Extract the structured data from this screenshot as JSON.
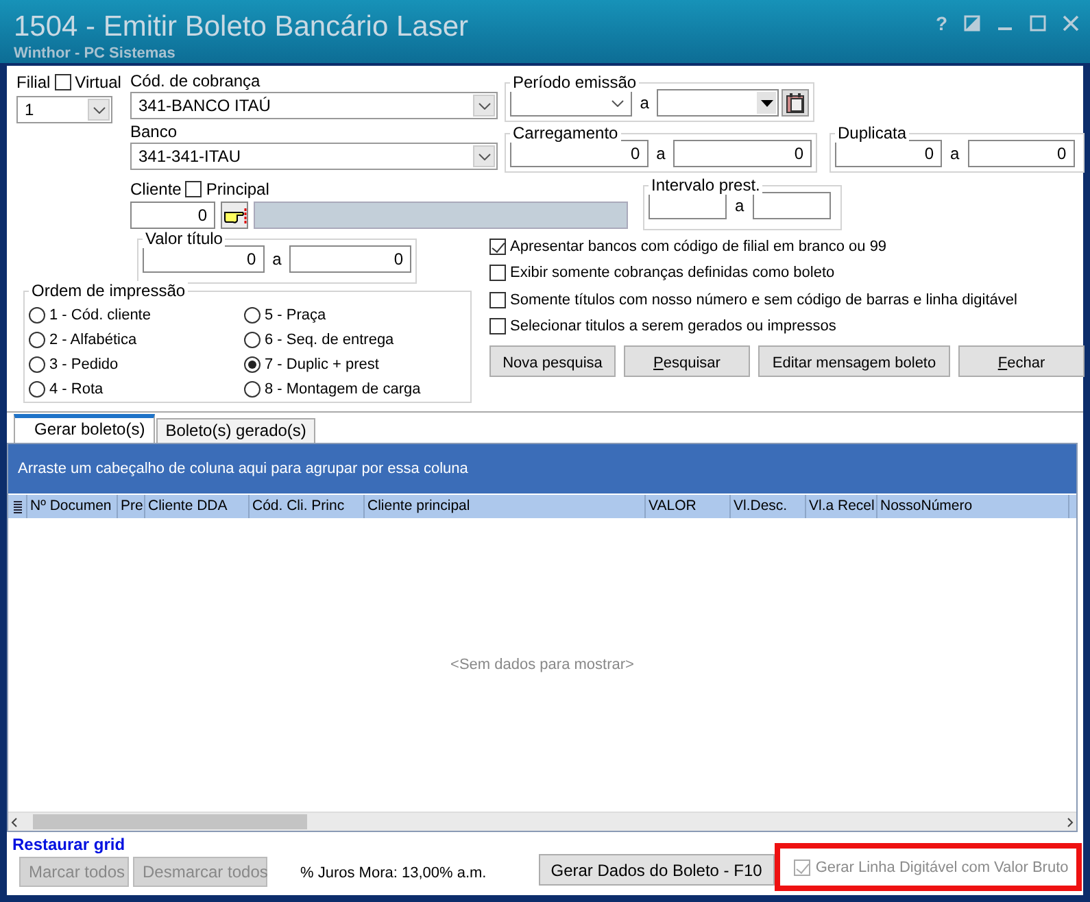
{
  "window": {
    "title": "1504 - Emitir Boleto Bancário Laser",
    "subtitle": "Winthor - PC Sistemas",
    "help": "?"
  },
  "filial": {
    "label": "Filial",
    "value": "1",
    "virtual": {
      "label": "Virtual",
      "checked": false
    }
  },
  "cod_cobranca": {
    "label": "Cód. de cobrança",
    "value": "341-BANCO ITAÚ"
  },
  "banco": {
    "label": "Banco",
    "value": "341-341-ITAU"
  },
  "periodo_emissao": {
    "label": "Período emissão",
    "separator": "a"
  },
  "carregamento": {
    "label": "Carregamento",
    "from": "0",
    "separator": "a",
    "to": "0"
  },
  "duplicata": {
    "label": "Duplicata",
    "from": "0",
    "separator": "a",
    "to": "0"
  },
  "cliente": {
    "label": "Cliente",
    "value": "0",
    "principal": {
      "label": "Principal",
      "checked": false
    }
  },
  "intervalo_prest": {
    "label": "Intervalo prest.",
    "separator": "a"
  },
  "valor_titulo": {
    "label": "Valor título",
    "from": "0",
    "separator": "a",
    "to": "0"
  },
  "ordem_impressao": {
    "label": "Ordem de impressão",
    "options": [
      {
        "label": "1 - Cód. cliente",
        "selected": false
      },
      {
        "label": "2 - Alfabética",
        "selected": false
      },
      {
        "label": "3 - Pedido",
        "selected": false
      },
      {
        "label": "4 - Rota",
        "selected": false
      },
      {
        "label": "5 - Praça",
        "selected": false
      },
      {
        "label": "6 - Seq. de entrega",
        "selected": false
      },
      {
        "label": "7 - Duplic + prest",
        "selected": true
      },
      {
        "label": "8 - Montagem de carga",
        "selected": false
      }
    ]
  },
  "options": [
    {
      "label": "Apresentar bancos com código de filial em branco ou 99",
      "checked": true
    },
    {
      "label": "Exibir somente cobranças definidas como boleto",
      "checked": false
    },
    {
      "label": "Somente títulos com nosso número e sem código de barras e linha digitável",
      "checked": false
    },
    {
      "label": "Selecionar titulos a serem gerados ou impressos",
      "checked": false
    }
  ],
  "buttons": [
    {
      "label": "Nova pesquisa"
    },
    {
      "parts": [
        {
          "text": "P",
          "underlined": true
        },
        {
          "text": "esquisar",
          "underlined": false
        }
      ]
    },
    {
      "label": "Editar mensagem boleto"
    },
    {
      "parts": [
        {
          "text": "F",
          "underlined": true
        },
        {
          "text": "echar",
          "underlined": false
        }
      ]
    }
  ],
  "tabs": [
    {
      "label": "Gerar boleto(s)",
      "selected": true
    },
    {
      "label": "Boleto(s) gerado(s)",
      "selected": false
    }
  ],
  "grid": {
    "group_hint": "Arraste um cabeçalho de coluna aqui para agrupar por essa coluna",
    "columns": [
      "Nº Documen",
      "Pre",
      "Cliente DDA",
      "Cód. Cli. Princ",
      "Cliente principal",
      "VALOR",
      "Vl.Desc.",
      "Vl.a Recel",
      "NossoNúmero"
    ],
    "empty": "<Sem dados para mostrar>"
  },
  "footer": {
    "restore_link": "Restaurar grid",
    "select_buttons": [
      {
        "label": "Marcar todos",
        "disabled": true
      },
      {
        "label": "Desmarcar todos",
        "disabled": true
      }
    ],
    "juros": "% Juros Mora: 13,00% a.m.",
    "generate_button": "Gerar Dados do Boleto - F10",
    "gross_value": {
      "label": "Gerar Linha Digitável com Valor Bruto",
      "checked": true,
      "disabled": true,
      "highlighted": true
    }
  }
}
